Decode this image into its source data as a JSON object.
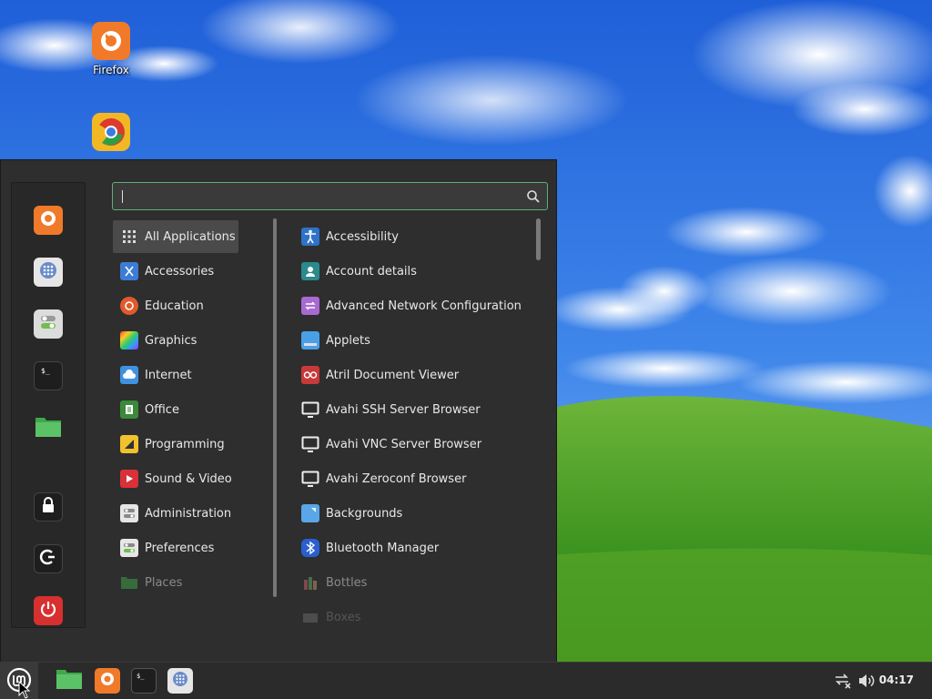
{
  "desktop": {
    "icons": [
      {
        "label": "Firefox",
        "icon": "firefox-icon"
      },
      {
        "label": "",
        "icon": "chrome-icon"
      }
    ]
  },
  "menu": {
    "search": {
      "value": "",
      "placeholder": ""
    },
    "favorites": [
      {
        "icon": "firefox-icon"
      },
      {
        "icon": "software-manager-icon"
      },
      {
        "icon": "settings-toggle-icon"
      },
      {
        "icon": "terminal-icon"
      },
      {
        "icon": "folder-icon"
      },
      {
        "icon": "lock-icon"
      },
      {
        "icon": "logout-icon"
      },
      {
        "icon": "power-icon"
      }
    ],
    "categories": [
      {
        "label": "All Applications",
        "icon": "grid-icon",
        "active": true
      },
      {
        "label": "Accessories",
        "icon": "scissors-icon"
      },
      {
        "label": "Education",
        "icon": "education-icon"
      },
      {
        "label": "Graphics",
        "icon": "graphics-icon"
      },
      {
        "label": "Internet",
        "icon": "cloud-icon"
      },
      {
        "label": "Office",
        "icon": "office-icon"
      },
      {
        "label": "Programming",
        "icon": "programming-icon"
      },
      {
        "label": "Sound & Video",
        "icon": "play-icon"
      },
      {
        "label": "Administration",
        "icon": "administration-icon"
      },
      {
        "label": "Preferences",
        "icon": "preferences-icon"
      },
      {
        "label": "Places",
        "icon": "folder-icon"
      }
    ],
    "apps": [
      {
        "label": "Accessibility",
        "icon": "accessibility-icon"
      },
      {
        "label": "Account details",
        "icon": "account-icon"
      },
      {
        "label": "Advanced Network Configuration",
        "icon": "network-icon"
      },
      {
        "label": "Applets",
        "icon": "applets-icon"
      },
      {
        "label": "Atril Document Viewer",
        "icon": "atril-icon"
      },
      {
        "label": "Avahi SSH Server Browser",
        "icon": "monitor-icon"
      },
      {
        "label": "Avahi VNC Server Browser",
        "icon": "monitor-icon"
      },
      {
        "label": "Avahi Zeroconf Browser",
        "icon": "monitor-icon"
      },
      {
        "label": "Backgrounds",
        "icon": "backgrounds-icon"
      },
      {
        "label": "Bluetooth Manager",
        "icon": "bluetooth-icon"
      },
      {
        "label": "Bottles",
        "icon": "bottles-icon"
      },
      {
        "label": "Boxes",
        "icon": "boxes-icon"
      }
    ]
  },
  "taskbar": {
    "launchers": [
      {
        "icon": "folder-icon"
      },
      {
        "icon": "firefox-icon"
      },
      {
        "icon": "terminal-icon"
      },
      {
        "icon": "software-manager-icon"
      }
    ],
    "tray": [
      {
        "icon": "network-disconnected-icon"
      },
      {
        "icon": "volume-icon"
      }
    ],
    "clock": "04:17"
  }
}
